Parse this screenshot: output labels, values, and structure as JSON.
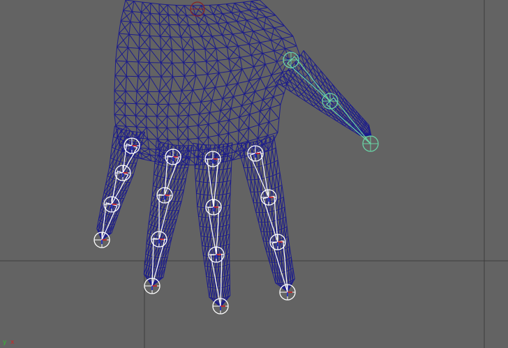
{
  "viewport": {
    "panel": "3d-perspective-viewport",
    "view_mode": "wireframe",
    "object": "hand-mesh",
    "colors": {
      "background": "#636363",
      "grid": "#3d3d3d",
      "mesh_wire": "#1b1b8c",
      "joint": "#ffffff",
      "selected_joint": "#69d4a6",
      "root_joint": "#8a2020",
      "axis_x": "#d52020",
      "axis_y": "#30c030",
      "axis_z": "#2030d0"
    }
  },
  "axis_indicator": {
    "y_label": "y",
    "x_label": "x"
  },
  "skeleton": {
    "chains": [
      {
        "name": "thumb",
        "selected": true,
        "joints": 3
      },
      {
        "name": "index",
        "selected": false,
        "joints": 4
      },
      {
        "name": "middle",
        "selected": false,
        "joints": 4
      },
      {
        "name": "ring",
        "selected": false,
        "joints": 4
      },
      {
        "name": "pinky",
        "selected": false,
        "joints": 4
      }
    ]
  }
}
